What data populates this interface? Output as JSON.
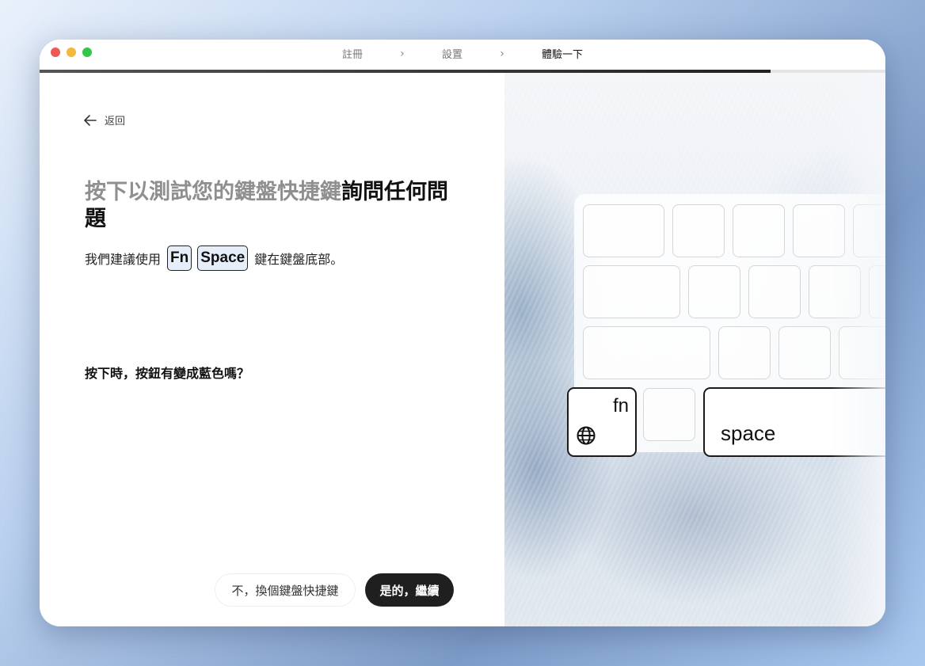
{
  "window": {
    "steps": [
      "註冊",
      "設置",
      "體驗一下"
    ],
    "active_step": 2,
    "progress_fraction": 0.864
  },
  "back": {
    "label": "返回"
  },
  "headline": {
    "muted": "按下以測試您的鍵盤快捷鍵",
    "strong": "詢問任何問題"
  },
  "suggestion": {
    "prefix": "我們建議使用",
    "key1": "Fn",
    "key2": "Space",
    "suffix": "鍵在鍵盤底部。"
  },
  "question": "按下時，按鈕有變成藍色嗎？",
  "buttons": {
    "no_label": "不，換個鍵盤快捷鍵",
    "yes_label": "是的，繼續"
  },
  "keyboard": {
    "fn_key_label": "fn",
    "space_key_label": "space",
    "globe_icon": "globe-icon"
  },
  "colors": {
    "primary_button": "#1f1f1f",
    "key_highlight_bg": "#e6eefa",
    "muted_heading": "#8f8f8f"
  }
}
